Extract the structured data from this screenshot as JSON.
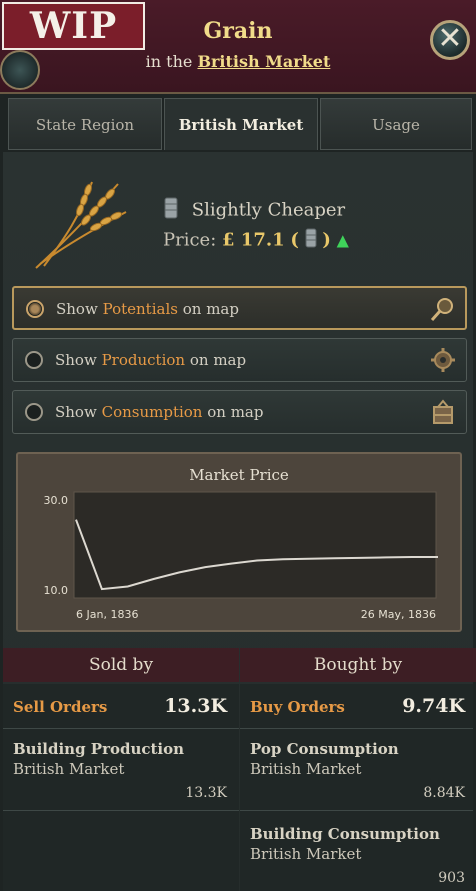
{
  "header": {
    "wip_label": "WIP",
    "title": "Grain",
    "subtitle_prefix": "in the",
    "subtitle_link": "British Market"
  },
  "tabs": [
    {
      "label": "State Region",
      "active": false
    },
    {
      "label": "British Market",
      "active": true
    },
    {
      "label": "Usage",
      "active": false
    }
  ],
  "good": {
    "status": "Slightly Cheaper",
    "price_label": "Price:",
    "price_value": "£ 17.1",
    "paren_open": "(",
    "paren_close": ")"
  },
  "toggles": [
    {
      "prefix": "Show",
      "keyword": "Potentials",
      "suffix": "on map",
      "active": true,
      "icon": "magnifier-icon"
    },
    {
      "prefix": "Show",
      "keyword": "Production",
      "suffix": "on map",
      "active": false,
      "icon": "gear-icon"
    },
    {
      "prefix": "Show",
      "keyword": "Consumption",
      "suffix": "on map",
      "active": false,
      "icon": "crate-icon"
    }
  ],
  "chart_data": {
    "type": "line",
    "title": "Market Price",
    "y_ticks": [
      "30.0",
      "10.0"
    ],
    "ylim": [
      10.0,
      30.0
    ],
    "x_labels": [
      "6 Jan, 1836",
      "26 May, 1836"
    ],
    "series": [
      {
        "values": [
          26.0,
          10.2,
          10.8,
          12.5,
          14.0,
          15.2,
          16.0,
          16.7,
          17.0,
          17.1,
          17.2,
          17.3,
          17.4,
          17.5,
          17.5
        ]
      }
    ]
  },
  "sold_by": {
    "header": "Sold by",
    "orders_label": "Sell Orders",
    "orders_value": "13.3K",
    "sources": [
      {
        "title": "Building Production",
        "market": "British Market",
        "value": "13.3K"
      }
    ]
  },
  "bought_by": {
    "header": "Bought by",
    "orders_label": "Buy Orders",
    "orders_value": "9.74K",
    "sources": [
      {
        "title": "Pop Consumption",
        "market": "British Market",
        "value": "8.84K"
      },
      {
        "title": "Building Consumption",
        "market": "British Market",
        "value": "903"
      }
    ]
  },
  "colors": {
    "accent": "#e79a46",
    "title_gold": "#f1dc8a",
    "up_arrow": "#3fd35a",
    "header_bg": "#3a1520"
  }
}
